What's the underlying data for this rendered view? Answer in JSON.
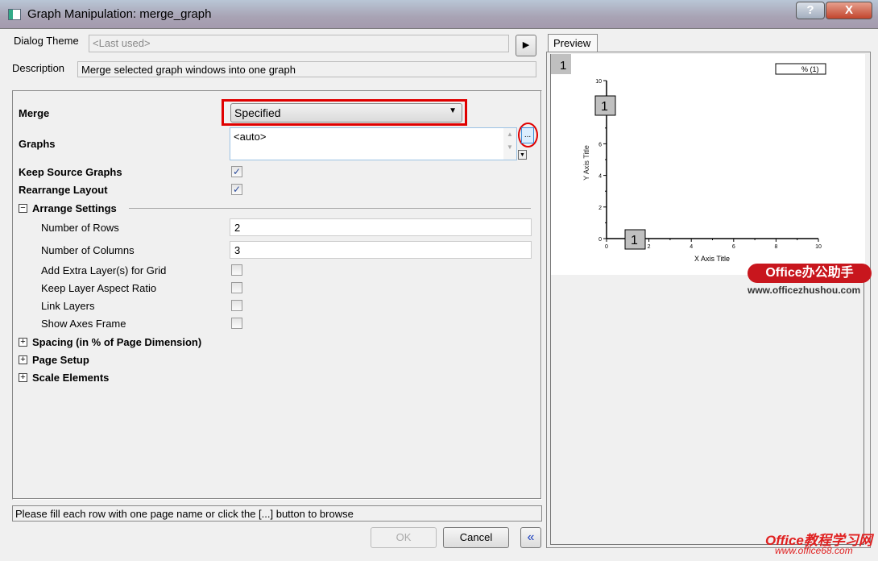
{
  "window": {
    "title": "Graph Manipulation: merge_graph",
    "help_label": "?",
    "close_label": "X"
  },
  "theme": {
    "label": "Dialog Theme",
    "value": "<Last used>"
  },
  "description": {
    "label": "Description",
    "value": "Merge selected graph windows into one graph"
  },
  "form": {
    "merge": {
      "label": "Merge",
      "value": "Specified"
    },
    "graphs": {
      "label": "Graphs",
      "value": "<auto>",
      "browse_label": "..."
    },
    "keep_source": {
      "label": "Keep Source Graphs",
      "checked": true
    },
    "rearrange": {
      "label": "Rearrange Layout",
      "checked": true
    },
    "arrange": {
      "label": "Arrange Settings",
      "expanded": true,
      "rows": {
        "label": "Number of Rows",
        "value": "2"
      },
      "cols": {
        "label": "Number of Columns",
        "value": "3"
      },
      "extra_layers": {
        "label": "Add Extra Layer(s) for Grid",
        "checked": false
      },
      "aspect": {
        "label": "Keep Layer Aspect Ratio",
        "checked": false
      },
      "link": {
        "label": "Link Layers",
        "checked": false
      },
      "axes_frame": {
        "label": "Show Axes Frame",
        "checked": false
      }
    },
    "spacing": {
      "label": "Spacing (in % of Page Dimension)"
    },
    "page_setup": {
      "label": "Page Setup"
    },
    "scale": {
      "label": "Scale Elements"
    }
  },
  "status": "Please fill each row with one page name or click the [...] button to browse",
  "buttons": {
    "ok": "OK",
    "cancel": "Cancel",
    "collapse": "«"
  },
  "preview": {
    "tab": "Preview",
    "layer_label": "1",
    "legend": "% (1)",
    "marker_y": "1",
    "marker_x": "1",
    "watermark1": "Office办公助手",
    "watermark1_url": "www.officezhushou.com",
    "watermark2": "Office教程学习网",
    "watermark2_url": "www.office68.com",
    "chart_data": {
      "type": "scatter",
      "xlabel": "X Axis Title",
      "ylabel": "Y Axis Title",
      "xlim": [
        0,
        10
      ],
      "ylim": [
        0,
        10
      ],
      "xticks": [
        "0",
        "2",
        "4",
        "6",
        "8",
        "10"
      ],
      "yticks": [
        "0",
        "2",
        "4",
        "6",
        "8",
        "10"
      ],
      "series": []
    }
  },
  "colors": {
    "highlight": "#e00000",
    "accent": "#1a3fbf"
  }
}
